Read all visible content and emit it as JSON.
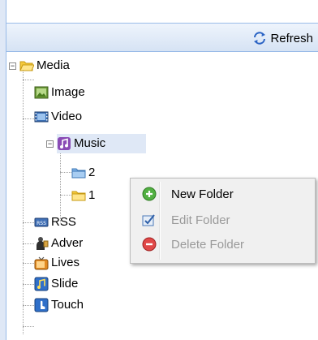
{
  "toolbar": {
    "refresh_label": "Refresh"
  },
  "tree": {
    "root": {
      "label": "Media"
    },
    "children": [
      {
        "label": "Image"
      },
      {
        "label": "Video"
      },
      {
        "label": "Music",
        "children": [
          {
            "label": "2"
          },
          {
            "label": "1"
          }
        ]
      },
      {
        "label": "RSS"
      },
      {
        "label": "Adver"
      },
      {
        "label": "Lives"
      },
      {
        "label": "Slide"
      },
      {
        "label": "Touch"
      }
    ]
  },
  "context_menu": {
    "items": [
      {
        "label": "New Folder",
        "enabled": true,
        "icon": "add-circle-icon"
      },
      {
        "label": "Edit Folder",
        "enabled": false,
        "icon": "edit-icon"
      },
      {
        "label": "Delete Folder",
        "enabled": false,
        "icon": "remove-circle-icon"
      }
    ]
  }
}
